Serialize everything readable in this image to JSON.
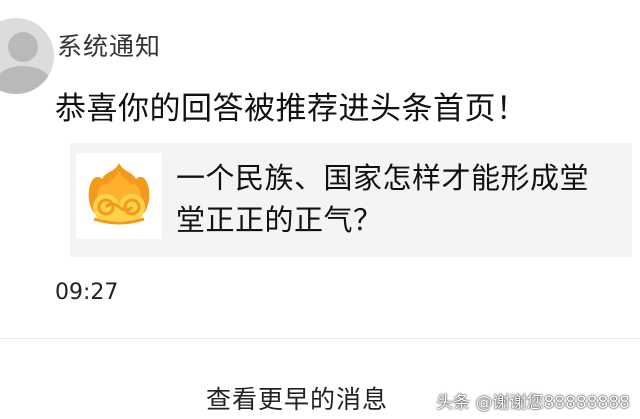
{
  "notification": {
    "sender": "系统通知",
    "message": "恭喜你的回答被推荐进头条首页！",
    "card": {
      "thumbnail_icon": "golden-cloud-logo-icon",
      "title": "一个民族、国家怎样才能形成堂堂正正的正气？"
    },
    "time": "09:27"
  },
  "footer": {
    "more_label": "查看更早的消息"
  },
  "watermark": {
    "text": "头条 @谢谢您88888888"
  },
  "colors": {
    "card_background": "#f4f4f4",
    "logo_orange": "#f29a1c",
    "logo_yellow": "#ffd24a"
  }
}
